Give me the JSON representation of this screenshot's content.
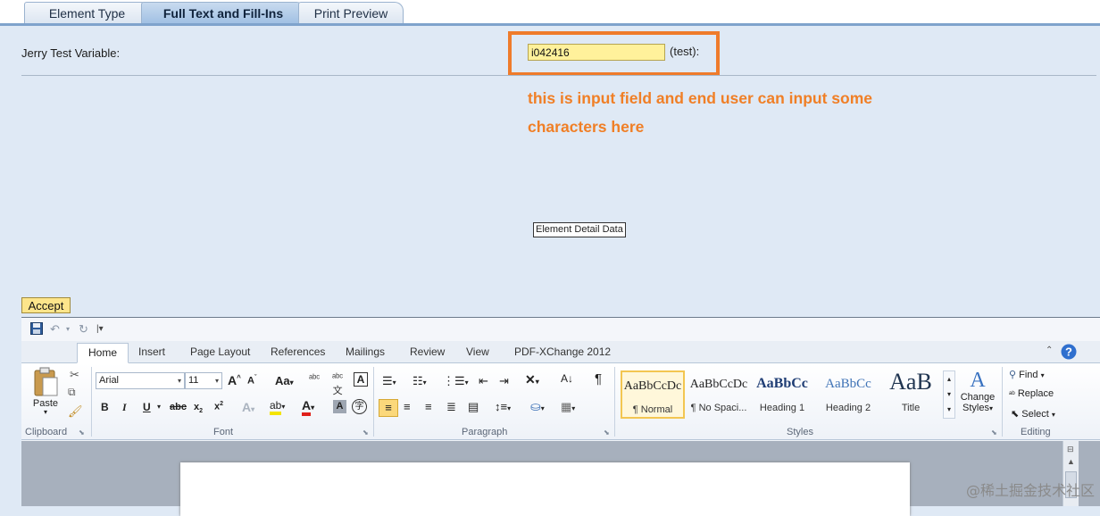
{
  "tabs": [
    {
      "label": "Element Type",
      "active": false
    },
    {
      "label": "Full Text and Fill-Ins",
      "active": true
    },
    {
      "label": "Print Preview",
      "active": false
    }
  ],
  "form": {
    "variable_label": "Jerry Test Variable:",
    "input_value": "i042416",
    "suffix_label": "(test):",
    "annotation_line1": "this is input field and end user can input some",
    "annotation_line2": "characters here",
    "tooltip": "Element Detail Data",
    "accept_label": "Accept"
  },
  "word": {
    "ribbon_tabs": [
      "Home",
      "Insert",
      "Page Layout",
      "References",
      "Mailings",
      "Review",
      "View",
      "PDF-XChange 2012"
    ],
    "active_tab": "Home",
    "clipboard": {
      "paste_label": "Paste",
      "group_label": "Clipboard"
    },
    "font": {
      "font_name": "Arial",
      "font_size": "11",
      "group_label": "Font"
    },
    "paragraph": {
      "group_label": "Paragraph"
    },
    "styles": {
      "items": [
        {
          "sample": "AaBbCcDc",
          "name": "¶ Normal",
          "selected": true
        },
        {
          "sample": "AaBbCcDc",
          "name": "¶ No Spaci...",
          "selected": false
        },
        {
          "sample": "AaBbCc",
          "name": "Heading 1",
          "selected": false
        },
        {
          "sample": "AaBbCc",
          "name": "Heading 2",
          "selected": false
        },
        {
          "sample": "AaB",
          "name": "Title",
          "selected": false
        }
      ],
      "change_styles_line1": "Change",
      "change_styles_line2": "Styles",
      "group_label": "Styles"
    },
    "editing": {
      "find": "Find",
      "replace": "Replace",
      "select": "Select",
      "group_label": "Editing"
    }
  },
  "watermark": "@稀土掘金技术社区",
  "colors": {
    "accent_orange": "#ef7b2b",
    "input_yellow": "#fff19b",
    "accept_yellow": "#fde58b"
  }
}
